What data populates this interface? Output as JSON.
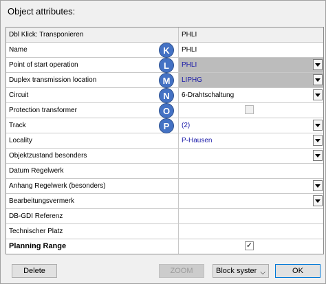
{
  "dialog": {
    "title": "Object attributes:"
  },
  "rows": [
    {
      "label": "Dbl Klick: Transponieren",
      "value": "PHLI",
      "header": true
    },
    {
      "label": "Name",
      "value": "PHLI",
      "badge": "K"
    },
    {
      "label": "Point of start operation",
      "value": "PHLI",
      "badge": "L",
      "dropdown": true,
      "value_style": "grey-blue"
    },
    {
      "label": "Duplex transmission location",
      "value": "LIPHG",
      "badge": "M",
      "dropdown": true,
      "value_style": "grey-blue"
    },
    {
      "label": "Circuit",
      "value": "6-Drahtschaltung",
      "badge": "N",
      "dropdown": true
    },
    {
      "label": "Protection transformer",
      "value": "",
      "badge": "O",
      "checkbox": "disabled"
    },
    {
      "label": "Track",
      "value": "(2)",
      "badge": "P",
      "dropdown": true,
      "value_style": "blue"
    },
    {
      "label": "Locality",
      "value": "P-Hausen",
      "dropdown": true,
      "value_style": "blue"
    },
    {
      "label": "Objektzustand besonders",
      "value": "",
      "dropdown": true
    },
    {
      "label": "Datum Regelwerk",
      "value": ""
    },
    {
      "label": "Anhang Regelwerk (besonders)",
      "value": "",
      "dropdown": true
    },
    {
      "label": "Bearbeitungsvermerk",
      "value": "",
      "dropdown": true
    },
    {
      "label": "DB-GDI Referenz",
      "value": ""
    },
    {
      "label": "Technischer Platz",
      "value": ""
    },
    {
      "label": "Planning Range",
      "value": "",
      "checkbox": "checked",
      "bold": true
    }
  ],
  "footer": {
    "delete_label": "Delete",
    "zoom_label": "ZOOM",
    "select_value": "Block syster",
    "ok_label": "OK"
  },
  "icons": {
    "checkmark": "✓",
    "chevron": "⌵"
  }
}
